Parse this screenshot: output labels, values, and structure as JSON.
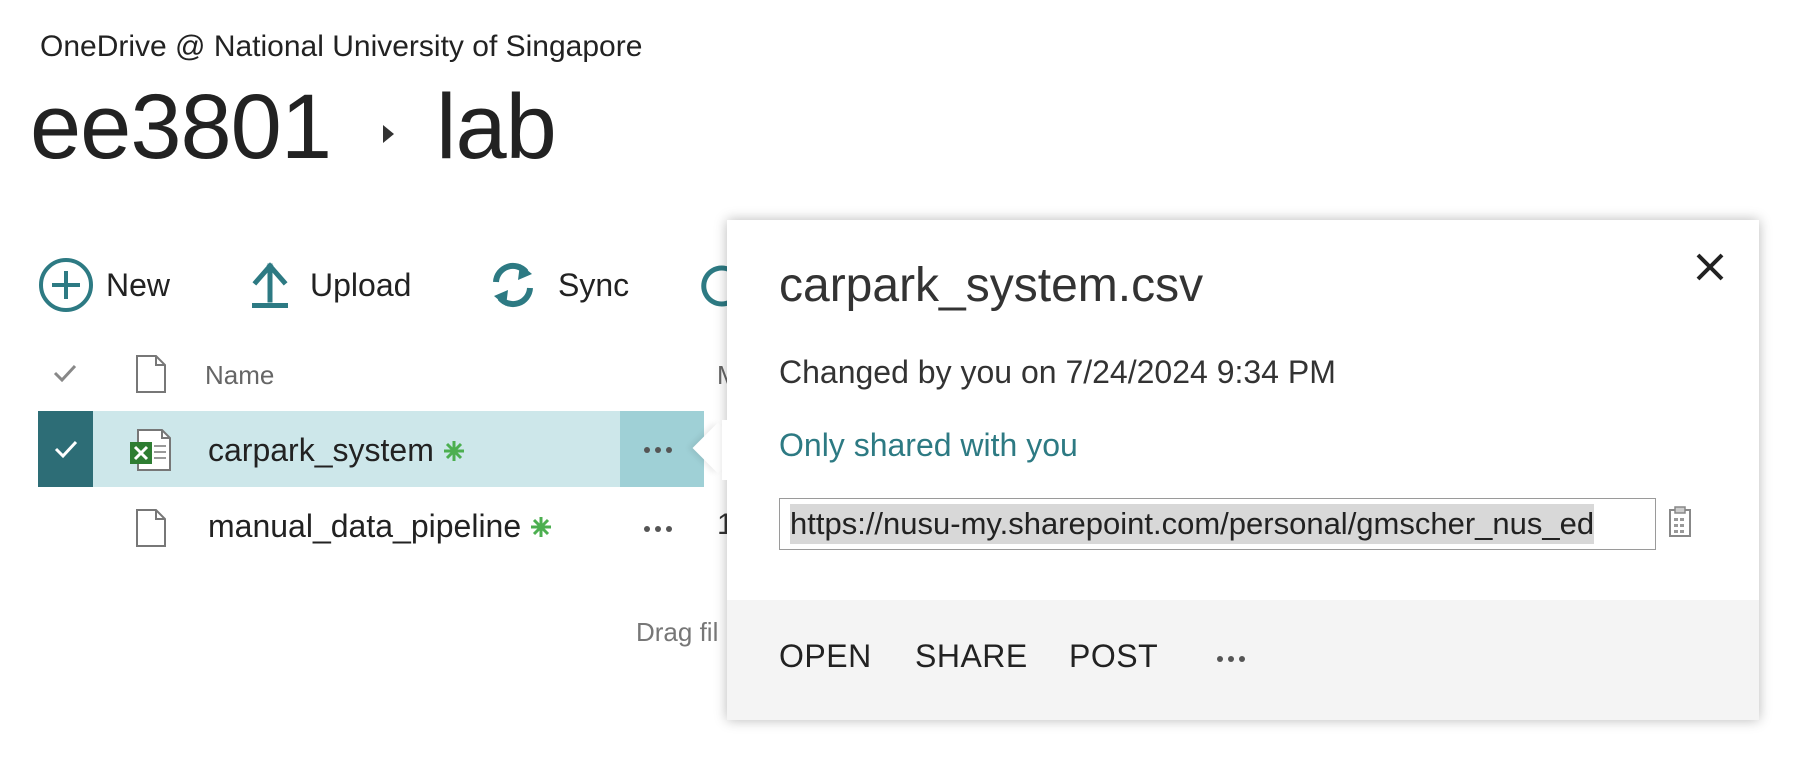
{
  "header": {
    "site_title": "OneDrive @ National University of Singapore",
    "breadcrumb": [
      "ee3801",
      "lab"
    ]
  },
  "commands": {
    "new_label": "New",
    "upload_label": "Upload",
    "sync_label": "Sync"
  },
  "list": {
    "column_name": "Name",
    "column_partial": "M",
    "rows": [
      {
        "name": "carpark_system",
        "selected": true,
        "icon": "excel-file-icon",
        "new_badge": true,
        "partial_col": ""
      },
      {
        "name": "manual_data_pipeline",
        "selected": false,
        "icon": "generic-file-icon",
        "new_badge": true,
        "partial_col": "1"
      }
    ],
    "drag_hint": "Drag fil"
  },
  "callout": {
    "title": "carpark_system.csv",
    "changed": "Changed by you on 7/24/2024 9:34 PM",
    "shared": "Only shared with you",
    "url": "https://nusu-my.sharepoint.com/personal/gmscher_nus_ed",
    "actions": {
      "open": "OPEN",
      "share": "SHARE",
      "post": "POST"
    }
  },
  "colors": {
    "accent": "#2d7a83",
    "selected_row": "#cde7ea",
    "selected_check": "#2d6d76",
    "new_badge": "#4caf50"
  }
}
